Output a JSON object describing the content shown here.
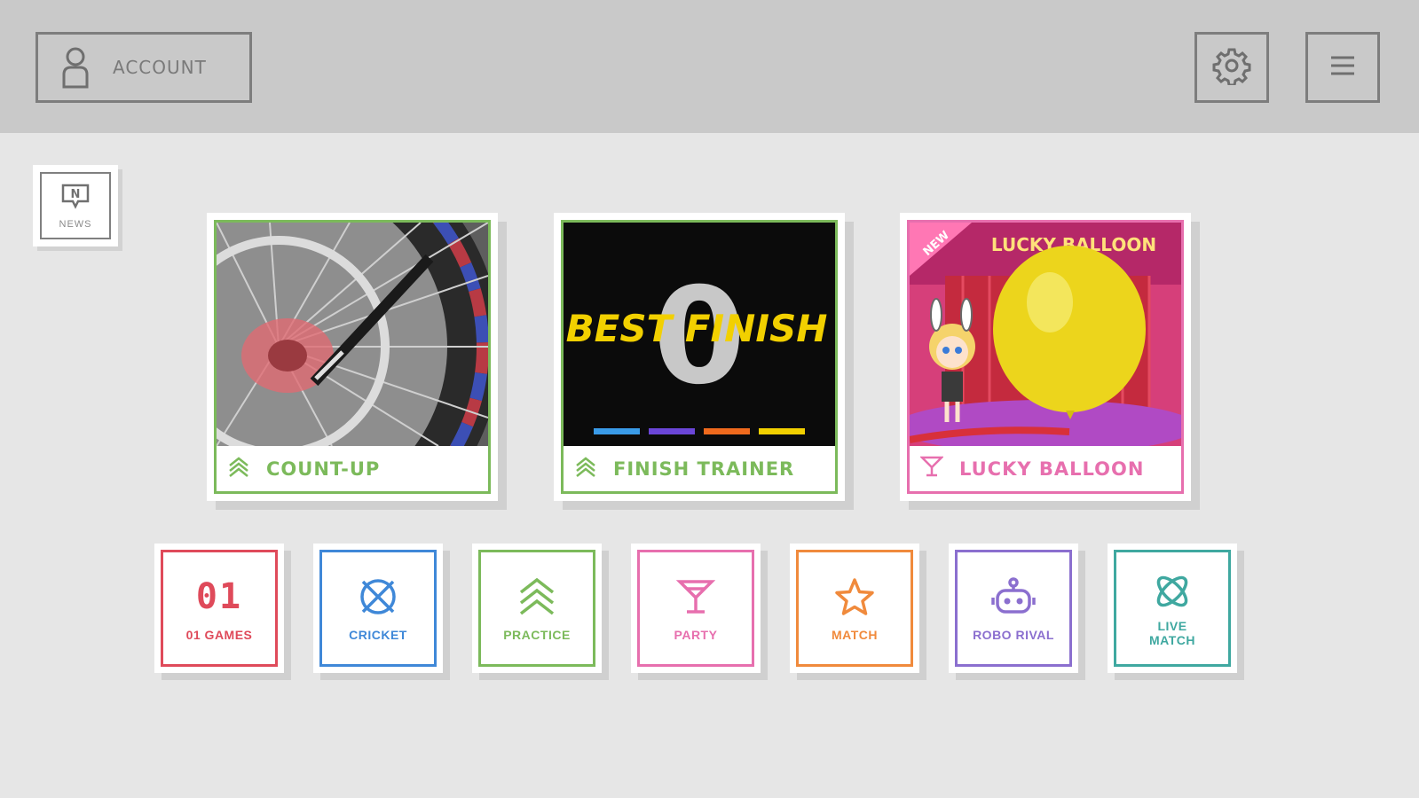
{
  "header": {
    "account_label": "ACCOUNT",
    "icons": {
      "account": "person-icon",
      "settings": "gear-icon",
      "menu": "hamburger-menu-icon"
    }
  },
  "news": {
    "label": "NEWS",
    "icon": "news-bubble-icon",
    "icon_letter": "N"
  },
  "featured": [
    {
      "label": "COUNT-UP",
      "icon": "practice-chevrons-icon",
      "color": "#7cba5b"
    },
    {
      "label": "FINISH TRAINER",
      "icon": "practice-chevrons-icon",
      "color": "#7cba5b",
      "art_title": "BEST FINISH",
      "art_number": "0"
    },
    {
      "label": "LUCKY BALLOON",
      "icon": "cocktail-glass-icon",
      "color": "#e76fae",
      "art_title": "LUCKY BALLOON",
      "art_ribbon": "NEW"
    }
  ],
  "modes": [
    {
      "label": "01 GAMES",
      "glyph": "01",
      "icon": "01-icon",
      "color": "#df4a5a"
    },
    {
      "label": "CRICKET",
      "icon": "cricket-target-icon",
      "color": "#3f88d8"
    },
    {
      "label": "PRACTICE",
      "icon": "practice-chevrons-icon",
      "color": "#7cba5b"
    },
    {
      "label": "PARTY",
      "icon": "cocktail-glass-icon",
      "color": "#e76fae"
    },
    {
      "label": "MATCH",
      "icon": "star-icon",
      "color": "#f08a3c"
    },
    {
      "label": "ROBO RIVAL",
      "icon": "robot-icon",
      "color": "#8b6fcf"
    },
    {
      "label": "LIVE MATCH",
      "icon": "live-match-icon",
      "color": "#3fa8a0"
    }
  ]
}
